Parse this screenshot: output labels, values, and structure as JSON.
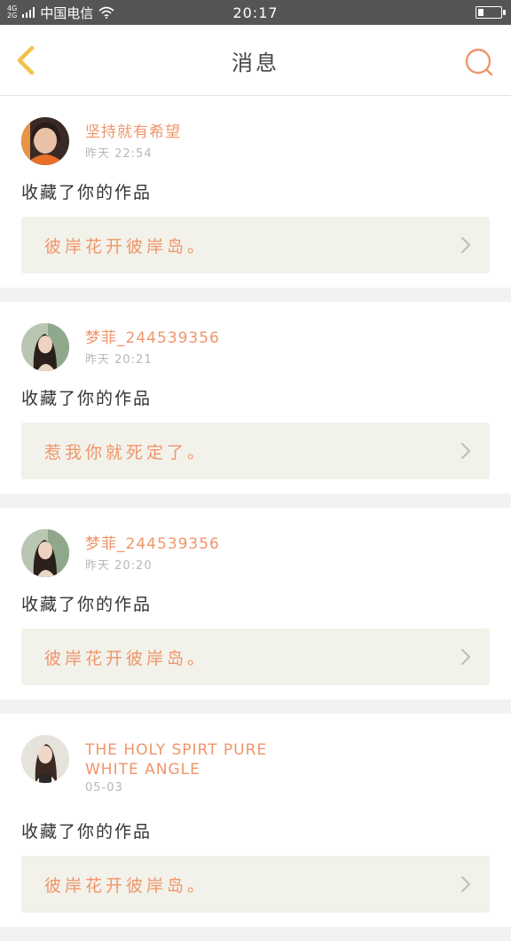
{
  "status_bar": {
    "network_top": "4G",
    "network_bottom": "2G",
    "carrier": "中国电信",
    "time": "20:17",
    "battery_level": 0.25
  },
  "header": {
    "title": "消息",
    "back_icon": "chevron-left-icon",
    "search_icon": "search-icon"
  },
  "colors": {
    "accent": "#f0956a",
    "back_icon": "#f1c24a",
    "card_bg": "#f2f2ea",
    "page_bg": "#f2f2f2"
  },
  "notifications": [
    {
      "user": "坚持就有希望",
      "time": "昨天 22:54",
      "action": "收藏了你的作品",
      "work_title": "彼岸花开彼岸岛。"
    },
    {
      "user": "梦菲_244539356",
      "time": "昨天 20:21",
      "action": "收藏了你的作品",
      "work_title": "惹我你就死定了。"
    },
    {
      "user": "梦菲_244539356",
      "time": "昨天 20:20",
      "action": "收藏了你的作品",
      "work_title": "彼岸花开彼岸岛。"
    },
    {
      "user": "THE HOLY SPIRT PURE WHITE ANGLE",
      "time": "05-03",
      "action": "收藏了你的作品",
      "work_title": "彼岸花开彼岸岛。"
    }
  ]
}
